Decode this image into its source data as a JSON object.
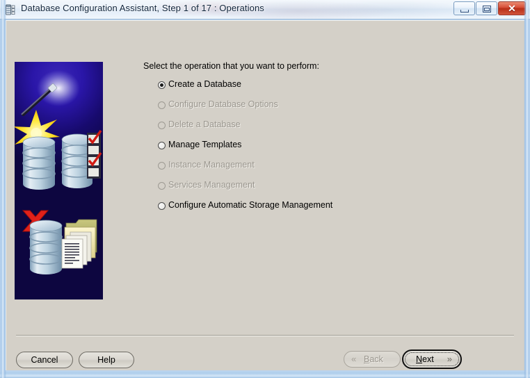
{
  "window": {
    "title": "Database Configuration Assistant, Step 1 of 17 : Operations",
    "icon": "database-grid-icon",
    "controls": {
      "minimize_label": "Minimize",
      "maximize_label": "Maximize",
      "close_label": "✕"
    }
  },
  "main": {
    "prompt": "Select the operation that you want to perform:",
    "options": [
      {
        "label": "Create a Database",
        "selected": true,
        "enabled": true,
        "name": "create-a-database"
      },
      {
        "label": "Configure Database Options",
        "selected": false,
        "enabled": false,
        "name": "configure-database-options"
      },
      {
        "label": "Delete a Database",
        "selected": false,
        "enabled": false,
        "name": "delete-a-database"
      },
      {
        "label": "Manage Templates",
        "selected": false,
        "enabled": true,
        "name": "manage-templates"
      },
      {
        "label": "Instance Management",
        "selected": false,
        "enabled": false,
        "name": "instance-management"
      },
      {
        "label": "Services Management",
        "selected": false,
        "enabled": false,
        "name": "services-management"
      },
      {
        "label": "Configure Automatic Storage Management",
        "selected": false,
        "enabled": true,
        "name": "configure-automatic-storage-management"
      }
    ],
    "illustration": {
      "name": "database-wizard-illustration",
      "elements": [
        "magic-wand",
        "sparkle-star",
        "database-cylinder",
        "checklist",
        "red-x",
        "folder",
        "documents"
      ]
    }
  },
  "footer": {
    "cancel_label": "Cancel",
    "help_label": "Help",
    "back_label": "Back",
    "back_mnemonic": "B",
    "back_rest": "ack",
    "back_chevron": "«",
    "next_label": "Next",
    "next_mnemonic": "N",
    "next_rest": "ext",
    "next_chevron": "»"
  },
  "colors": {
    "dialog_face": "#d4d0c8",
    "title_text": "#12263c",
    "close_red": "#c03a22",
    "disabled_text": "#9b978f",
    "art_blue": "#2413a0"
  }
}
